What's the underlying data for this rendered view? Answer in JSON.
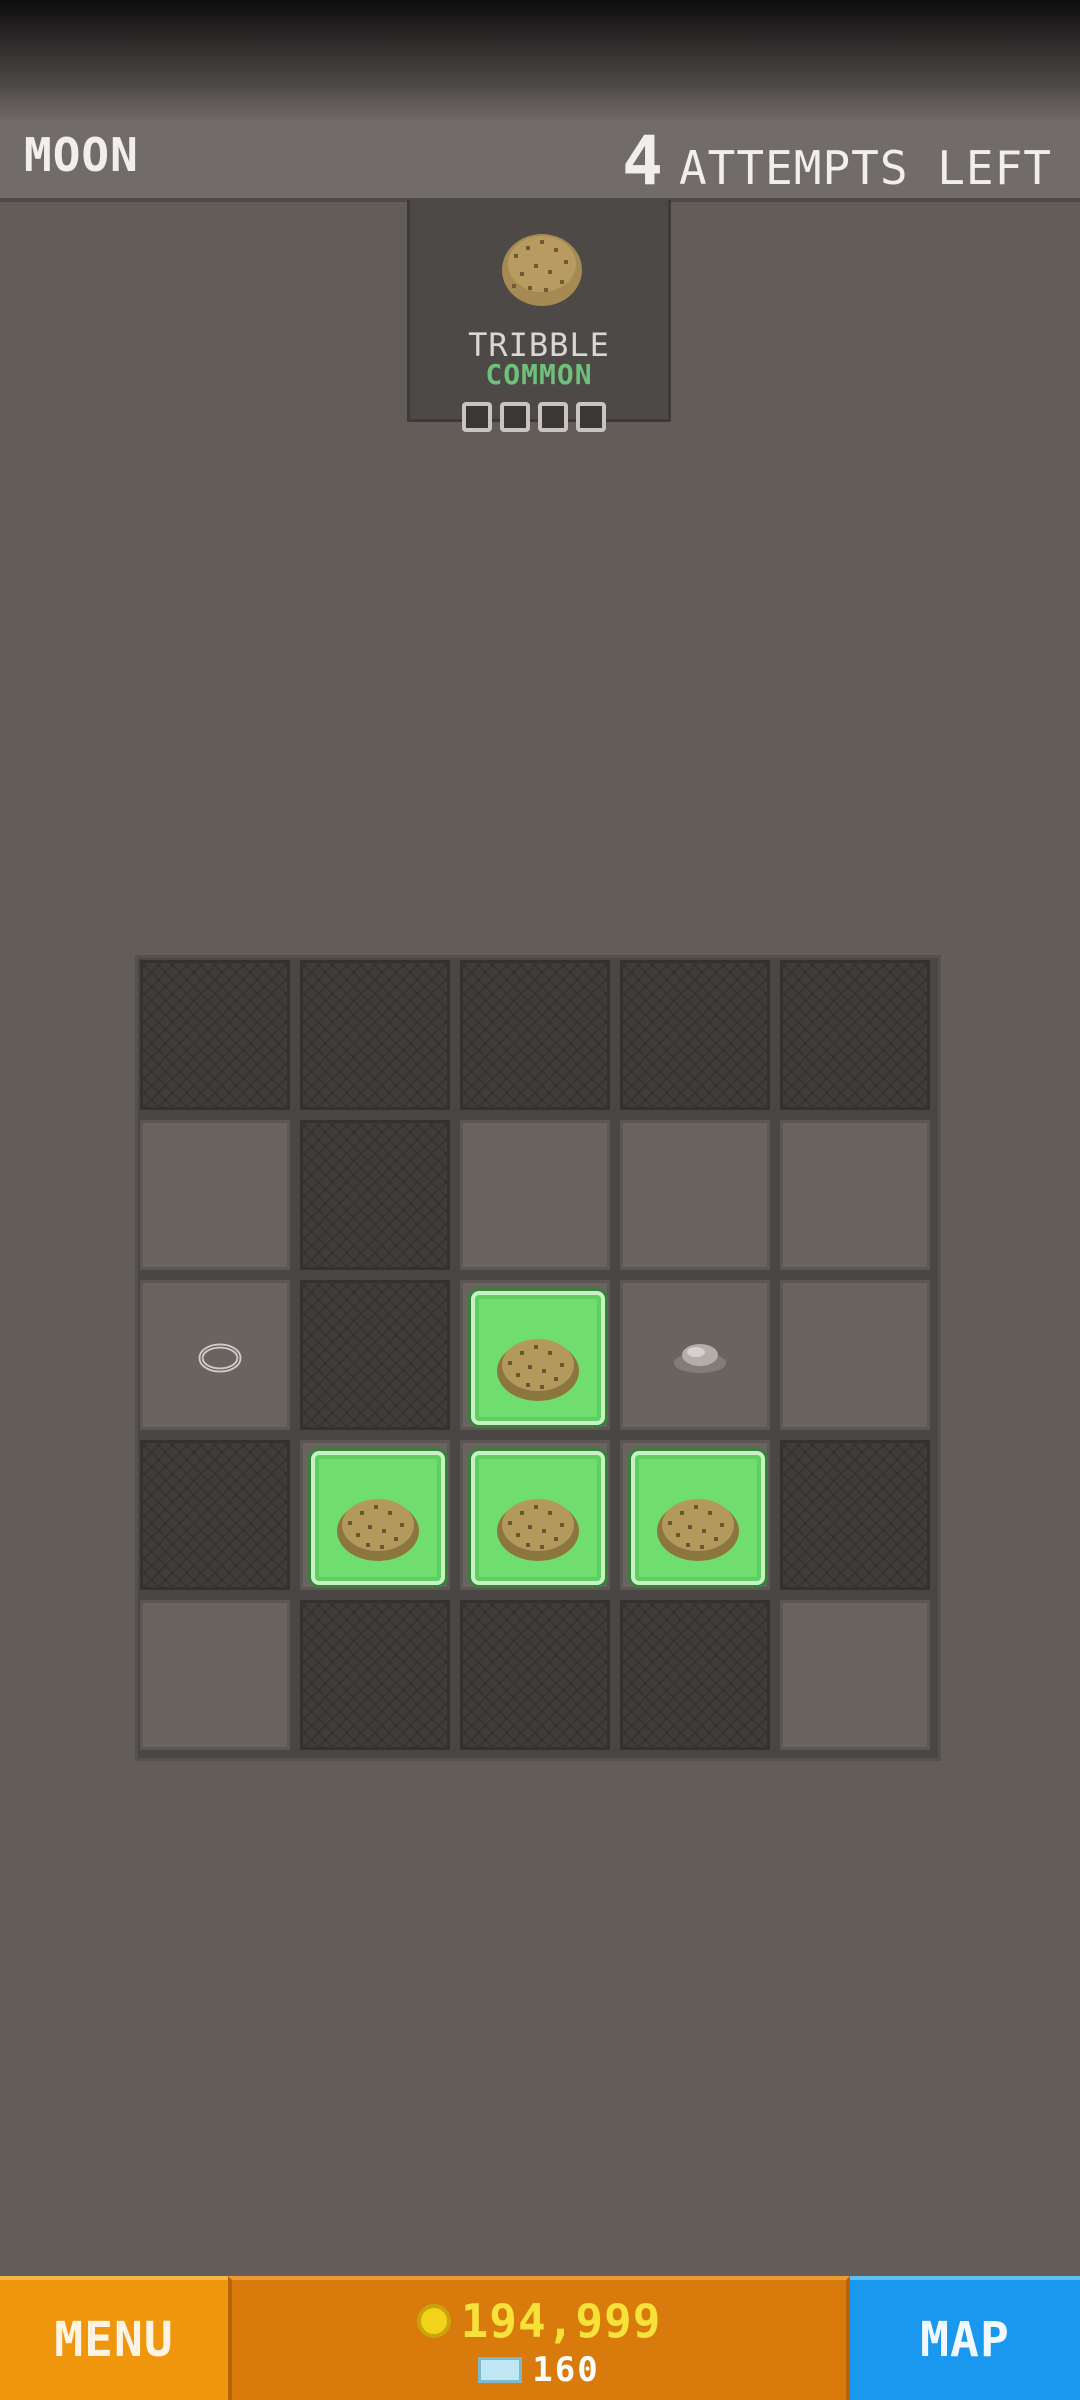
{
  "header": {
    "level_name": "MOON",
    "attempts_count": "4",
    "attempts_label": "ATTEMPTS LEFT"
  },
  "target": {
    "name": "TRIBBLE",
    "rarity": "COMMON",
    "pips_total": 4,
    "pips_found": 0
  },
  "board": {
    "rows": [
      [
        "empty",
        "empty",
        "empty",
        "empty",
        "empty"
      ],
      [
        "dug",
        "empty",
        "dug",
        "dug",
        "dug"
      ],
      [
        "dug-ring",
        "empty",
        "found",
        "dug-rock",
        "dug"
      ],
      [
        "empty",
        "found",
        "found",
        "found",
        "empty"
      ],
      [
        "dug",
        "empty",
        "empty",
        "empty",
        "dug"
      ]
    ]
  },
  "footer": {
    "menu_label": "MENU",
    "coins": "194,999",
    "gems": "160",
    "map_label": "MAP"
  },
  "colors": {
    "found_tile": "#6fde6f",
    "rarity_common": "#6ec07a",
    "menu_button": "#f0960c",
    "map_button": "#1a97ee",
    "coin": "#f7e23a"
  }
}
